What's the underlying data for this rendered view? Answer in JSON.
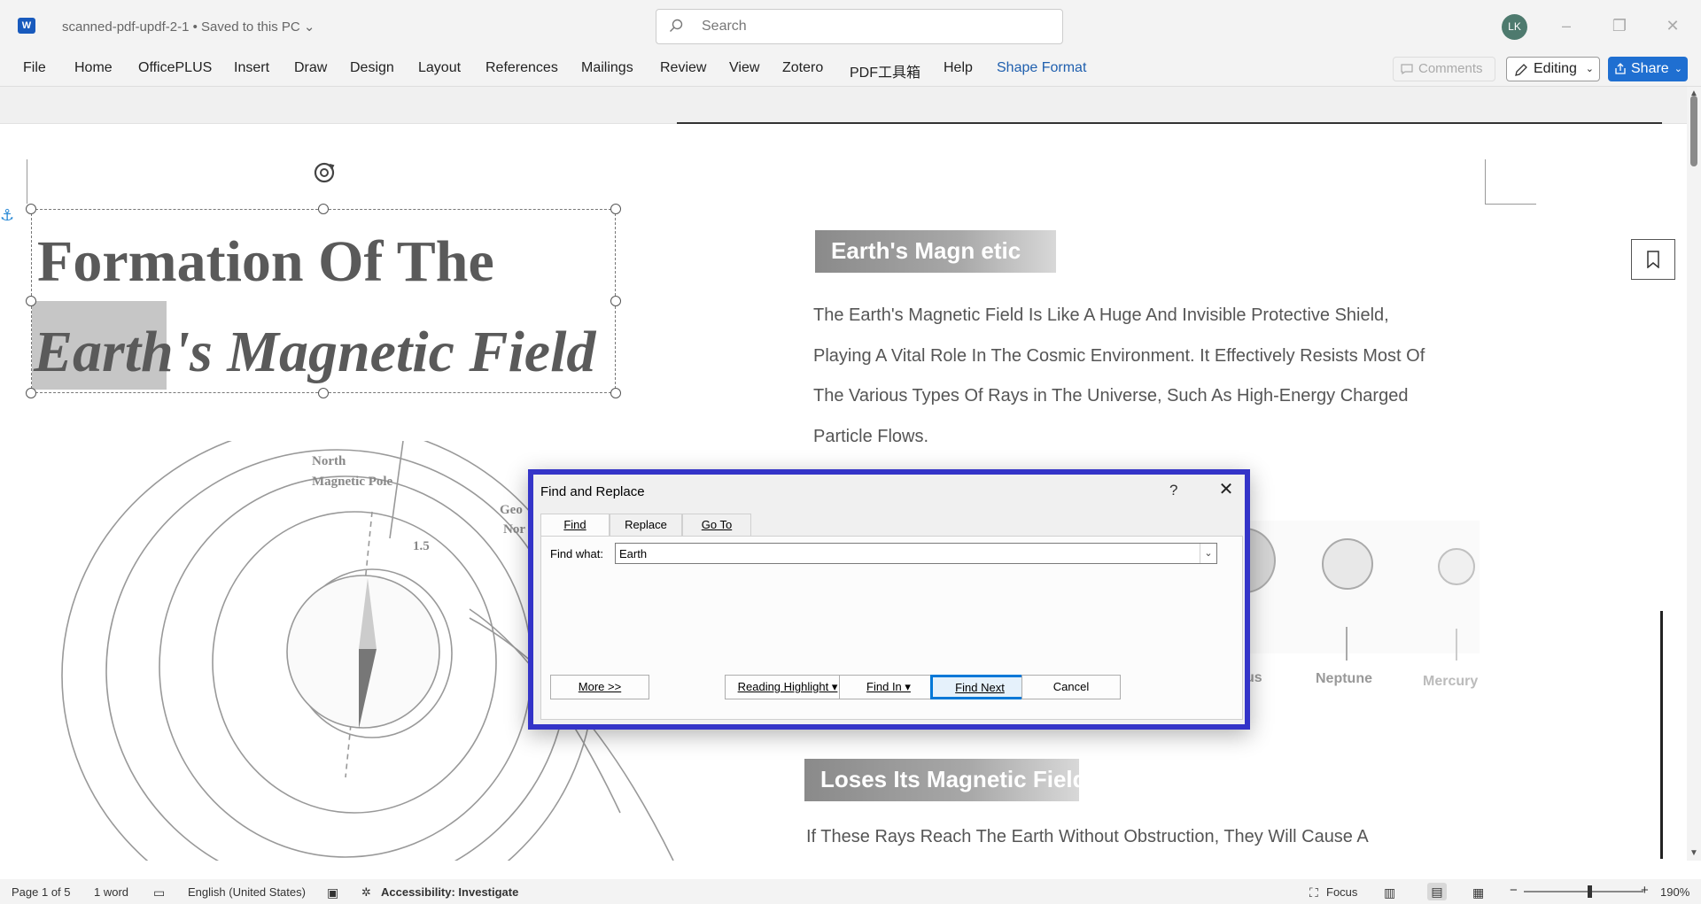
{
  "titlebar": {
    "app_icon": "W",
    "doc_title": "scanned-pdf-updf-2-1 • Saved to this PC ⌄",
    "search_placeholder": "Search",
    "avatar_initials": "LK"
  },
  "ribbon": {
    "tabs": [
      "File",
      "Home",
      "OfficePLUS",
      "Insert",
      "Draw",
      "Design",
      "Layout",
      "References",
      "Mailings",
      "Review",
      "View",
      "Zotero",
      "PDF工具箱",
      "Help",
      "Shape Format"
    ],
    "comments_label": "Comments",
    "editing_label": "Editing",
    "share_label": "Share"
  },
  "document": {
    "title_line1": "Formation Of The",
    "title_line2": "Earth's Magnetic Field",
    "section1_heading": "Earth's Magn etic",
    "paragraph1_lines": [
      "The Earth's Magnetic Field Is Like A Huge And Invisible Protective Shield,",
      "Playing A Vital Role In The Cosmic Environment. It Effectively Resists Most Of",
      "The Various Types Of Rays in The Universe, Such As High-Energy Charged",
      "Particle Flows."
    ],
    "figure_labels": {
      "north_pole_line1": "North",
      "north_pole_line2": "Magnetic Pole",
      "geo_line1": "Geo",
      "geo_line2": "Nor",
      "angle": "1.5"
    },
    "planet_labels": [
      "us",
      "Neptune",
      "Mercury"
    ],
    "section2_heading": "Loses Its Magnetic Field",
    "paragraph2": "If These Rays Reach The Earth Without Obstruction, They Will Cause A"
  },
  "dialog": {
    "title": "Find and Replace",
    "help": "?",
    "tabs": [
      "Find",
      "Replace",
      "Go To"
    ],
    "find_label": "Find what:",
    "find_value": "Earth",
    "buttons": {
      "more": "More >>",
      "reading_highlight": "Reading Highlight ▾",
      "find_in": "Find In ▾",
      "find_next": "Find Next",
      "cancel": "Cancel"
    }
  },
  "statusbar": {
    "page": "Page 1 of 5",
    "words": "1 word",
    "language": "English (United States)",
    "accessibility": "Accessibility: Investigate",
    "focus": "Focus",
    "zoom": "190%"
  },
  "colors": {
    "dialog_border": "#3434c8",
    "share_button": "#1f6fd1",
    "accent_tab": "#1f5fae"
  }
}
